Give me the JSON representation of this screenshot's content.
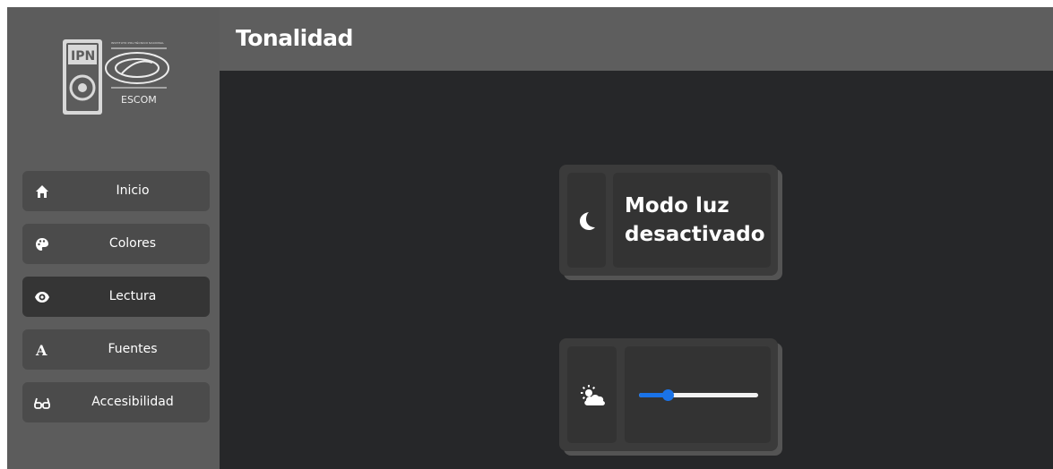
{
  "header": {
    "title": "Tonalidad"
  },
  "logo": {
    "small_text": "INSTITUTO POLITÉCNICO NACIONAL",
    "name": "ESCOM",
    "ipn_text": "IPN"
  },
  "nav": {
    "items": [
      {
        "label": "Inicio",
        "icon": "home-icon"
      },
      {
        "label": "Colores",
        "icon": "palette-icon"
      },
      {
        "label": "Lectura",
        "icon": "eye-icon"
      },
      {
        "label": "Fuentes",
        "icon": "font-icon"
      },
      {
        "label": "Accesibilidad",
        "icon": "glasses-icon"
      }
    ],
    "active_index": 2
  },
  "mode_card": {
    "line1": "Modo luz",
    "line2": "desactivado",
    "icon": "moon-icon"
  },
  "tone_card": {
    "icon": "sun-cloud-icon",
    "slider_value": 0.24,
    "slider_color": "#1a73e8"
  }
}
